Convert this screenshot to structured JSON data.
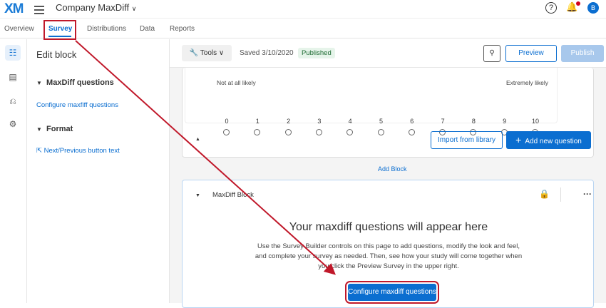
{
  "header": {
    "logo": "XM",
    "project": "Company MaxDiff",
    "help": "?",
    "avatar": "B"
  },
  "tabs": [
    "Overview",
    "Survey",
    "Distributions",
    "Data",
    "Reports"
  ],
  "panel": {
    "title": "Edit block",
    "section1": "MaxDiff questions",
    "link1": "Configure maxfiff questions",
    "section2": "Format",
    "link2": "Next/Previous button text"
  },
  "toolbar": {
    "tools": "Tools",
    "saved": "Saved 3/10/2020",
    "status": "Published",
    "preview": "Preview",
    "publish": "Publish"
  },
  "scale": {
    "low": "Not at all likely",
    "high": "Extremely likely",
    "points": [
      "0",
      "1",
      "2",
      "3",
      "4",
      "5",
      "6",
      "7",
      "8",
      "9",
      "10"
    ]
  },
  "block1": {
    "import": "Import from library",
    "add": "Add new question"
  },
  "add_block": "Add Block",
  "block2": {
    "title": "MaxDiff Block",
    "heading": "Your maxdiff questions will appear here",
    "body": "Use the Survey Builder controls on this page to add questions, modify the look and feel, and complete your survey as needed. Then, see how your study will come together when you click the Preview Survey in the upper right.",
    "button": "Configure maxdiff questions"
  },
  "colors": {
    "accent": "#0b6ed0",
    "annotation": "#c0182a"
  }
}
